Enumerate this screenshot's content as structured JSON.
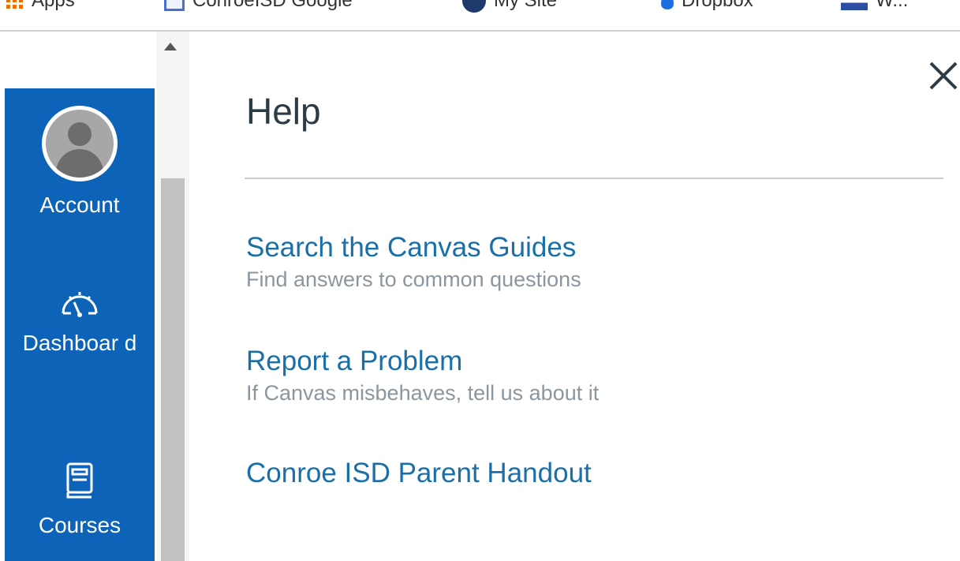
{
  "bookmarks": [
    {
      "icon": "apps-grid-icon",
      "label": "Apps"
    },
    {
      "icon": "bookmark-page-icon",
      "label": "ConroeISD Google"
    },
    {
      "icon": "circle-logo-icon",
      "label": "My Site"
    },
    {
      "icon": "dropbox-icon",
      "label": "Dropbox"
    },
    {
      "icon": "flag-icon",
      "label": "W..."
    }
  ],
  "global_nav": {
    "account_label": "Account",
    "dashboard_label": "Dashboar d",
    "courses_label": "Courses",
    "background_color": "#0c63b8"
  },
  "help_tray": {
    "title": "Help",
    "close_icon": "close-icon",
    "links": [
      {
        "title": "Search the Canvas Guides",
        "description": "Find answers to common questions"
      },
      {
        "title": "Report a Problem",
        "description": "If Canvas misbehaves, tell us about it"
      },
      {
        "title": "Conroe ISD Parent Handout",
        "description": ""
      }
    ],
    "link_color": "#1a6fa8"
  }
}
